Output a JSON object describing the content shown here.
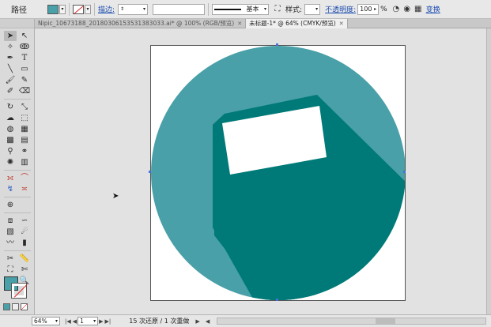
{
  "control_bar": {
    "selection_label": "路径",
    "fill_color": "#49a0a8",
    "stroke_link": "描边:",
    "stroke_weight": "",
    "brush_label": "基本",
    "style_label": "样式:",
    "opacity_link": "不透明度:",
    "opacity_value": "100",
    "percent": "%",
    "transform_link": "变换"
  },
  "tabs": [
    {
      "label": "Nipic_10673188_20180306153531383033.ai* @ 100% (RGB/预览)"
    },
    {
      "label": "未标题-1* @ 64% (CMYK/预览)"
    }
  ],
  "canvas": {
    "circle_color": "#49a0a8",
    "body_color": "#007a78",
    "card_color": "#ffffff"
  },
  "status": {
    "zoom": "64%",
    "artboard_number": "1",
    "undo_text": "15 次还原 / 1 次重做"
  },
  "tool_icons": [
    "selection-tool-icon",
    "direct-selection-tool-icon",
    "magic-wand-tool-icon",
    "lasso-tool-icon",
    "pen-tool-icon",
    "type-tool-icon",
    "line-tool-icon",
    "rectangle-tool-icon",
    "paintbrush-tool-icon",
    "pencil-tool-icon",
    "blob-brush-tool-icon",
    "eraser-tool-icon",
    "rotate-tool-icon",
    "scale-tool-icon",
    "warp-tool-icon",
    "free-transform-tool-icon",
    "shape-builder-tool-icon",
    "perspective-grid-tool-icon",
    "mesh-tool-icon",
    "gradient-tool-icon",
    "eyedropper-tool-icon",
    "blend-tool-icon",
    "symbol-sprayer-tool-icon",
    "column-graph-tool-icon",
    "artboard-tool-icon",
    "slice-tool-icon",
    "hand-tool-icon",
    "zoom-tool-icon"
  ]
}
